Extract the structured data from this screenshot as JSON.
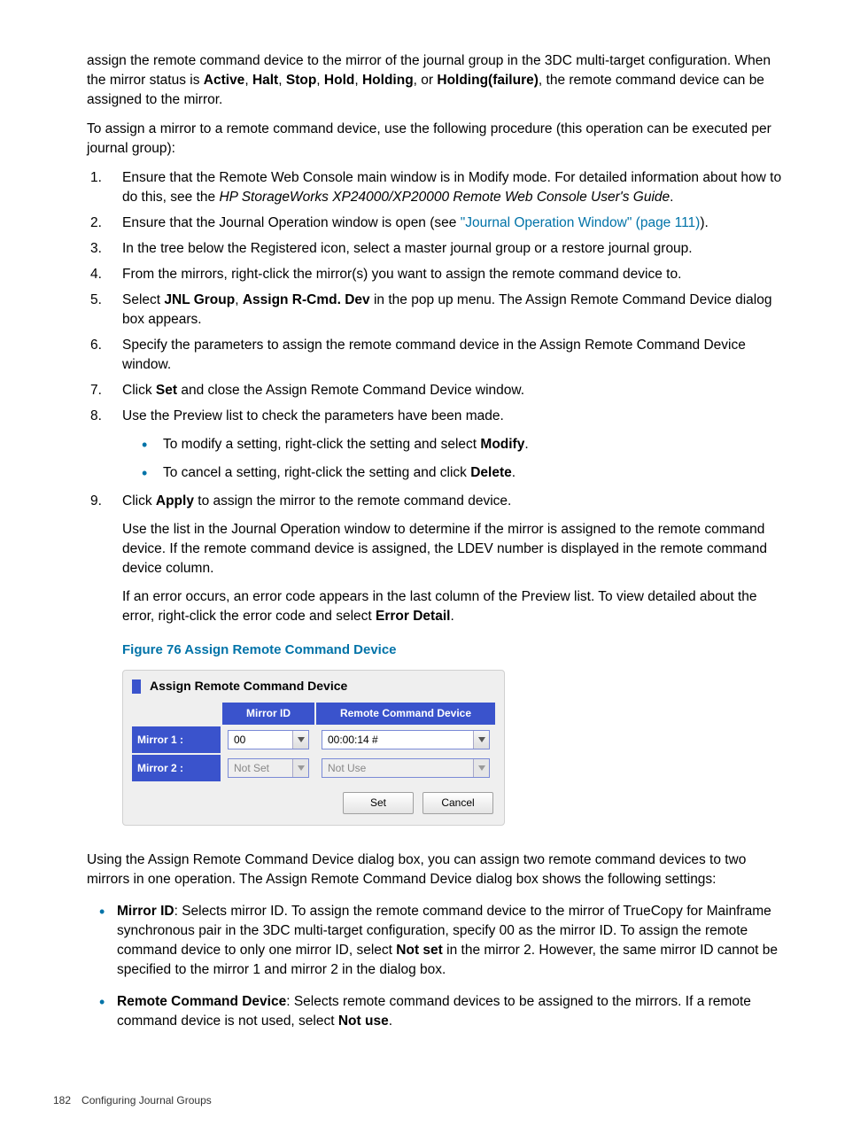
{
  "intro": {
    "p1_pre": "assign the remote command device to the mirror of the journal group in the 3DC multi-target configuration. When the mirror status is ",
    "states": [
      "Active",
      "Halt",
      "Stop",
      "Hold",
      "Holding",
      "Holding(failure)"
    ],
    "p1_post": ", the remote command device can be assigned to the mirror.",
    "p2": "To assign a mirror to a remote command device, use the following procedure (this operation can be executed per journal group):"
  },
  "steps": {
    "s1_a": "Ensure that the Remote Web Console main window is in Modify mode. For detailed information about how to do this, see the ",
    "s1_em": "HP StorageWorks XP24000/XP20000 Remote Web Console User's Guide",
    "s1_b": ".",
    "s2_a": "Ensure that the Journal Operation window is open (see ",
    "s2_link": "\"Journal Operation Window\" (page 111)",
    "s2_b": ").",
    "s3": "In the tree below the Registered icon, select a master journal group or a restore journal group.",
    "s4": "From the mirrors, right-click the mirror(s) you want to assign the remote command device to.",
    "s5_a": "Select ",
    "s5_b1": "JNL Group",
    "s5_mid": ", ",
    "s5_b2": "Assign R-Cmd. Dev",
    "s5_c": " in the pop up menu. The Assign Remote Command Device dialog box appears.",
    "s6": "Specify the parameters to assign the remote command device in the Assign Remote Command Device window.",
    "s7_a": "Click ",
    "s7_b": "Set",
    "s7_c": " and close the Assign Remote Command Device window.",
    "s8": "Use the Preview list to check the parameters have been made.",
    "s8_sub1_a": "To modify a setting, right-click the setting and select ",
    "s8_sub1_b": "Modify",
    "s8_sub1_c": ".",
    "s8_sub2_a": "To cancel a setting, right-click the setting and click ",
    "s8_sub2_b": "Delete",
    "s8_sub2_c": ".",
    "s9_a": "Click ",
    "s9_b": "Apply",
    "s9_c": " to assign the mirror to the remote command device.",
    "s9_p1": "Use the list in the Journal Operation window to determine if the mirror is assigned to the remote command device. If the remote command device is assigned, the LDEV number is displayed in the remote command device column.",
    "s9_p2_a": "If an error occurs, an error code appears in the last column of the Preview list. To view detailed about the error, right-click the error code and select ",
    "s9_p2_b": "Error Detail",
    "s9_p2_c": "."
  },
  "figure": {
    "caption": "Figure 76 Assign Remote Command Device",
    "title": "Assign Remote Command Device",
    "header_mid": "Mirror ID",
    "header_rcd": "Remote Command Device",
    "row1_label": "Mirror 1 :",
    "row1_mid": "00",
    "row1_rcd": "00:00:14 #",
    "row2_label": "Mirror 2 :",
    "row2_mid": "Not Set",
    "row2_rcd": "Not Use",
    "btn_set": "Set",
    "btn_cancel": "Cancel"
  },
  "after": {
    "p1": "Using the Assign Remote Command Device dialog box, you can assign two remote command devices to two mirrors in one operation. The Assign Remote Command Device dialog box shows the following settings:",
    "b1_t": "Mirror ID",
    "b1_a": ": Selects mirror ID. To assign the remote command device to the mirror of TrueCopy for Mainframe synchronous pair in the 3DC multi-target configuration, specify 00 as the mirror ID. To assign the remote command device to only one mirror ID, select ",
    "b1_ns": "Not set",
    "b1_b": " in the mirror 2. However, the same mirror ID cannot be specified to the mirror 1 and mirror 2 in the dialog box.",
    "b2_t": "Remote Command Device",
    "b2_a": ": Selects remote command devices to be assigned to the mirrors. If a remote command device is not used, select ",
    "b2_nu": "Not use",
    "b2_b": "."
  },
  "footer": {
    "page": "182",
    "section": "Configuring Journal Groups"
  }
}
